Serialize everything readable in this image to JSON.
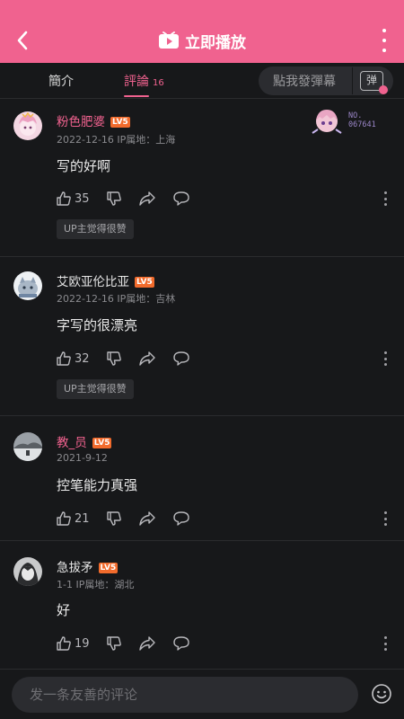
{
  "header": {
    "title": "立即播放",
    "accent": "#f0628f"
  },
  "tabs": [
    {
      "label": "簡介"
    },
    {
      "label": "評論",
      "count": "16"
    }
  ],
  "danmaku": {
    "placeholder": "點我發彈幕",
    "button": "弹"
  },
  "fan_badge": {
    "line1": "NO.",
    "line2": "067641"
  },
  "comments": [
    {
      "name": "粉色肥婆",
      "name_color": "#f0628f",
      "level": "LV5",
      "meta": "2022-12-16  IP属地：上海",
      "text": "写的好啊",
      "likes": "35",
      "tag": "UP主觉得很赞"
    },
    {
      "name": "艾欧亚伦比亚",
      "name_color": "#e6e6e6",
      "level": "LV5",
      "meta": "2022-12-16  IP属地：吉林",
      "text": "字写的很漂亮",
      "likes": "32",
      "tag": "UP主觉得很赞"
    },
    {
      "name": "教_员",
      "name_color": "#f0628f",
      "level": "LV5",
      "meta": "2021-9-12",
      "text": "控笔能力真强",
      "likes": "21",
      "tag": ""
    },
    {
      "name": "急拔矛",
      "name_color": "#e6e6e6",
      "level": "LV5",
      "meta": "1-1  IP属地：湖北",
      "text": "好",
      "likes": "19",
      "tag": ""
    }
  ],
  "input": {
    "placeholder": "发一条友善的评论"
  }
}
